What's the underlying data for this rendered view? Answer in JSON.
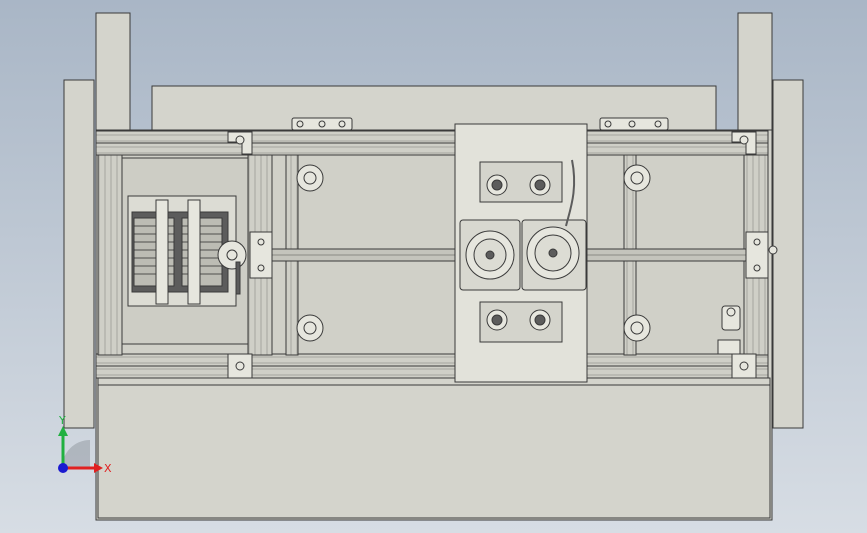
{
  "viewport": {
    "background_top": "#a9b6c6",
    "background_bottom": "#d7dde4"
  },
  "colors": {
    "frame_fill": "#d4d4cc",
    "frame_stroke": "#3a3a3a",
    "detail_fill": "#e6e6de",
    "dark_part": "#5c5c5c",
    "axis_x": "#e02020",
    "axis_y": "#20b040",
    "axis_origin": "#1a1ad0"
  },
  "triad": {
    "x_label": "X",
    "y_label": "Y"
  },
  "icons": {
    "triad": "xyz-axis-triad-icon",
    "motor": "motor-assembly-icon",
    "knob": "star-knob-icon",
    "gear": "spur-gear-icon"
  }
}
